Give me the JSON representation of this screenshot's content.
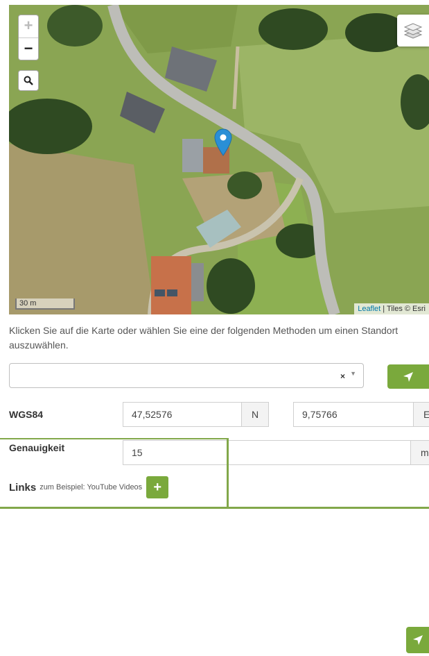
{
  "map": {
    "zoom_in": "+",
    "zoom_out": "−",
    "scale_label": "30 m",
    "attribution": {
      "leaflet": "Leaflet",
      "separator": " | ",
      "tiles": "Tiles © Esri"
    },
    "icons": [
      "search-icon",
      "layers-icon",
      "map-marker-icon"
    ]
  },
  "instruction": "Klicken Sie auf die Karte oder wählen Sie eine der folgenden Methoden um einen Standort auszuwählen.",
  "select": {
    "value": "",
    "clear": "×",
    "arrow": "▼"
  },
  "coordinates": {
    "label": "WGS84",
    "lat_value": "47,52576",
    "lat_unit": "N",
    "lon_value": "9,75766",
    "lon_unit": "E"
  },
  "accuracy": {
    "label": "Genauigkeit",
    "value": "15",
    "unit": "m"
  },
  "links": {
    "label": "Links",
    "hint": "zum Beispiel: YouTube Videos",
    "add": "+"
  },
  "colors": {
    "accent": "#7aa93c",
    "marker": "#2a8fd6",
    "highlight": "#82a84a"
  }
}
